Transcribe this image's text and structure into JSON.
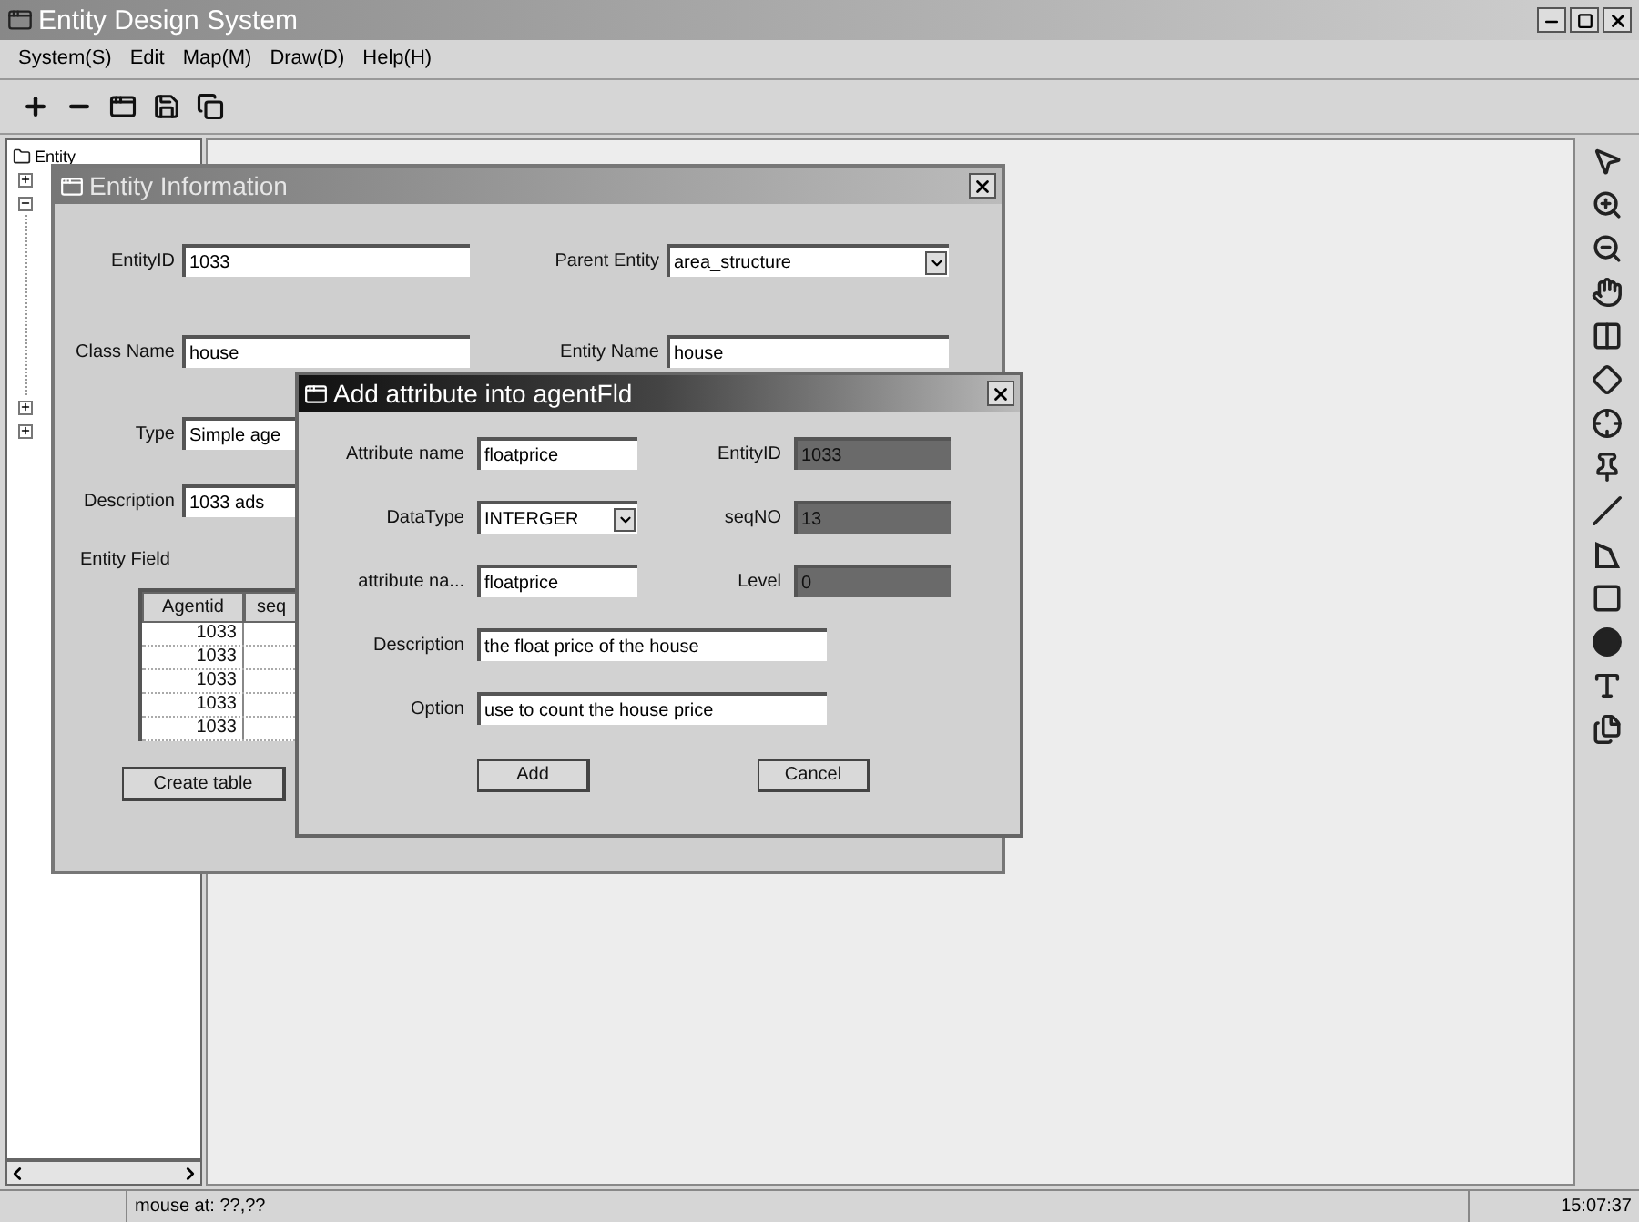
{
  "window": {
    "title": "Entity Design System"
  },
  "menu": [
    "System(S)",
    "Edit",
    "Map(M)",
    "Draw(D)",
    "Help(H)"
  ],
  "tree": {
    "root": "Entity",
    "nodes": [
      {
        "expanded": false
      },
      {
        "expanded": true
      },
      {
        "expanded": false
      },
      {
        "expanded": false
      }
    ]
  },
  "entity_dialog": {
    "title": "Entity Information",
    "fields": [
      {
        "label": "EntityID",
        "value": "1033",
        "kind": "text"
      },
      {
        "label": "Parent Entity",
        "value": "area_structure",
        "kind": "combo"
      },
      {
        "label": "Class Name",
        "value": "house",
        "kind": "text"
      },
      {
        "label": "Entity Name",
        "value": "house",
        "kind": "text"
      },
      {
        "label": "Type",
        "value": "Simple age",
        "kind": "text"
      },
      {
        "label": "Description",
        "value": "1033 ads",
        "kind": "text"
      }
    ],
    "section": "Entity Field",
    "table": {
      "columns": [
        "Agentid",
        "seq"
      ],
      "rows": [
        [
          "1033"
        ],
        [
          "1033"
        ],
        [
          "1033"
        ],
        [
          "1033"
        ],
        [
          "1033"
        ]
      ]
    },
    "buttons": [
      "Create table"
    ]
  },
  "attribute_dialog": {
    "title": "Add attribute into agentFld",
    "rows": [
      [
        {
          "label": "Attribute name",
          "value": "floatprice",
          "kind": "text",
          "disabled": false
        },
        {
          "label": "EntityID",
          "value": "1033",
          "kind": "text",
          "disabled": true
        }
      ],
      [
        {
          "label": "DataType",
          "value": "INTERGER",
          "kind": "combo",
          "disabled": false
        },
        {
          "label": "seqNO",
          "value": "13",
          "kind": "text",
          "disabled": true
        }
      ],
      [
        {
          "label": "attribute na...",
          "value": "floatprice",
          "kind": "text",
          "disabled": false
        },
        {
          "label": "Level",
          "value": "0",
          "kind": "text",
          "disabled": true
        }
      ],
      [
        {
          "label": "Description",
          "value": "the float price of the house",
          "kind": "wide",
          "disabled": false
        }
      ],
      [
        {
          "label": "Option",
          "value": "use to count the house price",
          "kind": "wide",
          "disabled": false
        }
      ]
    ],
    "buttons": [
      "Add",
      "Cancel"
    ]
  },
  "status_bar": {
    "message": "mouse at: ??,??",
    "time": "15:07:37"
  }
}
